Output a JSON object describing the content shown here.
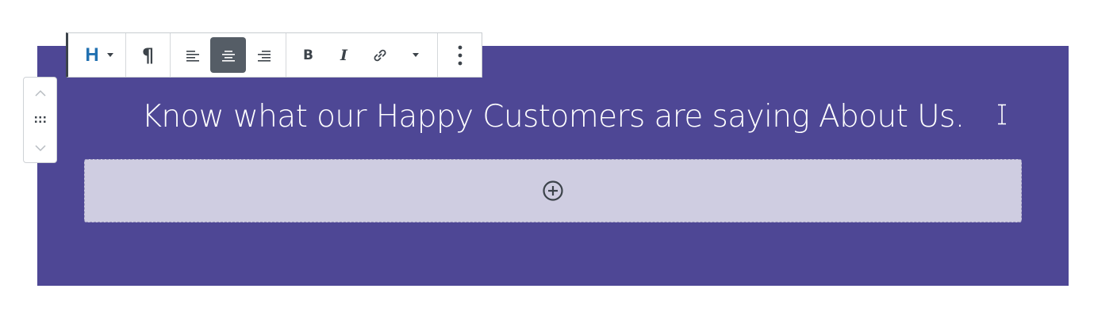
{
  "toolbar": {
    "heading_level_label": "H",
    "paragraph_symbol": "¶",
    "bold_label": "B",
    "italic_label": "I"
  },
  "block": {
    "heading": "Know what our Happy Customers are saying About Us."
  },
  "icons": {
    "mover_up": "chevron-up-icon",
    "mover_drag": "drag-handle-icon",
    "mover_down": "chevron-down-icon",
    "align_left": "align-left-icon",
    "align_center": "align-center-icon",
    "align_right": "align-right-icon",
    "link": "link-icon",
    "more_formats": "chevron-down-icon",
    "more_options": "more-vertical-icon",
    "add_block": "plus-circle-icon",
    "text_cursor": "text-cursor-icon"
  },
  "colors": {
    "cover_background": "#4e4795",
    "appender_background": "#cfcde1",
    "active_button": "#555d66",
    "heading_icon": "#2271b1"
  }
}
